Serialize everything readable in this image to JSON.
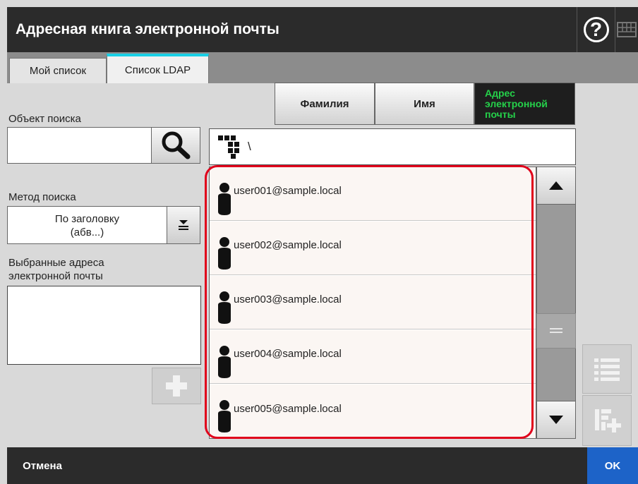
{
  "header": {
    "title": "Адресная книга электронной почты",
    "help_label": "?"
  },
  "tabs": [
    {
      "label": "Мой список",
      "active": false
    },
    {
      "label": "Список LDAP",
      "active": true
    }
  ],
  "search": {
    "label": "Объект поиска",
    "value": "",
    "method_label": "Метод поиска",
    "method_line1": "По заголовку",
    "method_line2": "(абв...)"
  },
  "selected": {
    "label_line1": "Выбранные адреса",
    "label_line2": "электронной почты"
  },
  "sort": {
    "surname": "Фамилия",
    "name": "Имя",
    "email_line1": "Адрес",
    "email_line2": "электронной",
    "email_line3": "почты"
  },
  "path": {
    "text": "\\"
  },
  "list": {
    "items": [
      {
        "email": "user001@sample.local"
      },
      {
        "email": "user002@sample.local"
      },
      {
        "email": "user003@sample.local"
      },
      {
        "email": "user004@sample.local"
      },
      {
        "email": "user005@sample.local"
      }
    ]
  },
  "footer": {
    "cancel_label": "Отмена",
    "ok_label": "OK"
  },
  "colors": {
    "header_bg": "#2b2b2b",
    "active_tab_accent": "#18d0e6",
    "active_sort_text": "#25d14a",
    "highlight": "#e0001b",
    "ok_bg": "#1d63c8"
  }
}
